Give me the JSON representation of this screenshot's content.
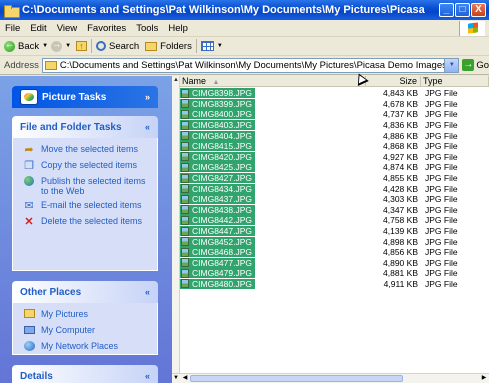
{
  "window": {
    "title": "C:\\Documents and Settings\\Pat Wilkinson\\My Documents\\My Pictures\\Picasa Demo I...",
    "min_glyph": "_",
    "max_glyph": "□",
    "close_glyph": "X"
  },
  "menu": [
    "File",
    "Edit",
    "View",
    "Favorites",
    "Tools",
    "Help"
  ],
  "toolbar": {
    "back_label": "Back",
    "search_label": "Search",
    "folders_label": "Folders"
  },
  "address": {
    "label": "Address",
    "value": "C:\\Documents and Settings\\Pat Wilkinson\\My Documents\\My Pictures\\Picasa Demo Images",
    "go_label": "Go"
  },
  "left_pane": {
    "picture_tasks": {
      "title": "Picture Tasks",
      "chevron": "»"
    },
    "file_folder_tasks": {
      "title": "File and Folder Tasks",
      "chevron": "«",
      "items": [
        {
          "label": "Move the selected items",
          "icon": "move-icon"
        },
        {
          "label": "Copy the selected items",
          "icon": "copy-icon"
        },
        {
          "label": "Publish the selected items to the Web",
          "icon": "publish-web-icon"
        },
        {
          "label": "E-mail the selected items",
          "icon": "email-icon"
        },
        {
          "label": "Delete the selected items",
          "icon": "delete-icon"
        }
      ]
    },
    "other_places": {
      "title": "Other Places",
      "chevron": "«",
      "items": [
        {
          "label": "My Pictures",
          "icon": "my-pictures-icon"
        },
        {
          "label": "My Computer",
          "icon": "my-computer-icon"
        },
        {
          "label": "My Network Places",
          "icon": "network-places-icon"
        }
      ]
    },
    "details": {
      "title": "Details",
      "chevron": "«"
    }
  },
  "file_list": {
    "columns": {
      "name": "Name",
      "size": "Size",
      "type": "Type"
    },
    "files": [
      {
        "name": "CIMG8398.JPG",
        "size": "4,843 KB",
        "type": "JPG File",
        "selected": true
      },
      {
        "name": "CIMG8399.JPG",
        "size": "4,678 KB",
        "type": "JPG File",
        "selected": true
      },
      {
        "name": "CIMG8400.JPG",
        "size": "4,737 KB",
        "type": "JPG File",
        "selected": true
      },
      {
        "name": "CIMG8403.JPG",
        "size": "4,836 KB",
        "type": "JPG File",
        "selected": true
      },
      {
        "name": "CIMG8404.JPG",
        "size": "4,886 KB",
        "type": "JPG File",
        "selected": true
      },
      {
        "name": "CIMG8415.JPG",
        "size": "4,868 KB",
        "type": "JPG File",
        "selected": true
      },
      {
        "name": "CIMG8420.JPG",
        "size": "4,927 KB",
        "type": "JPG File",
        "selected": true
      },
      {
        "name": "CIMG8425.JPG",
        "size": "4,874 KB",
        "type": "JPG File",
        "selected": true
      },
      {
        "name": "CIMG8427.JPG",
        "size": "4,855 KB",
        "type": "JPG File",
        "selected": true
      },
      {
        "name": "CIMG8434.JPG",
        "size": "4,428 KB",
        "type": "JPG File",
        "selected": true
      },
      {
        "name": "CIMG8437.JPG",
        "size": "4,303 KB",
        "type": "JPG File",
        "selected": true
      },
      {
        "name": "CIMG8438.JPG",
        "size": "4,347 KB",
        "type": "JPG File",
        "selected": true
      },
      {
        "name": "CIMG8442.JPG",
        "size": "4,758 KB",
        "type": "JPG File",
        "selected": true
      },
      {
        "name": "CIMG8447.JPG",
        "size": "4,139 KB",
        "type": "JPG File",
        "selected": true
      },
      {
        "name": "CIMG8452.JPG",
        "size": "4,898 KB",
        "type": "JPG File",
        "selected": true
      },
      {
        "name": "CIMG8468.JPG",
        "size": "4,856 KB",
        "type": "JPG File",
        "selected": true
      },
      {
        "name": "CIMG8477.JPG",
        "size": "4,890 KB",
        "type": "JPG File",
        "selected": true
      },
      {
        "name": "CIMG8479.JPG",
        "size": "4,881 KB",
        "type": "JPG File",
        "selected": true
      },
      {
        "name": "CIMG8480.JPG",
        "size": "4,911 KB",
        "type": "JPG File",
        "selected": true
      }
    ]
  }
}
